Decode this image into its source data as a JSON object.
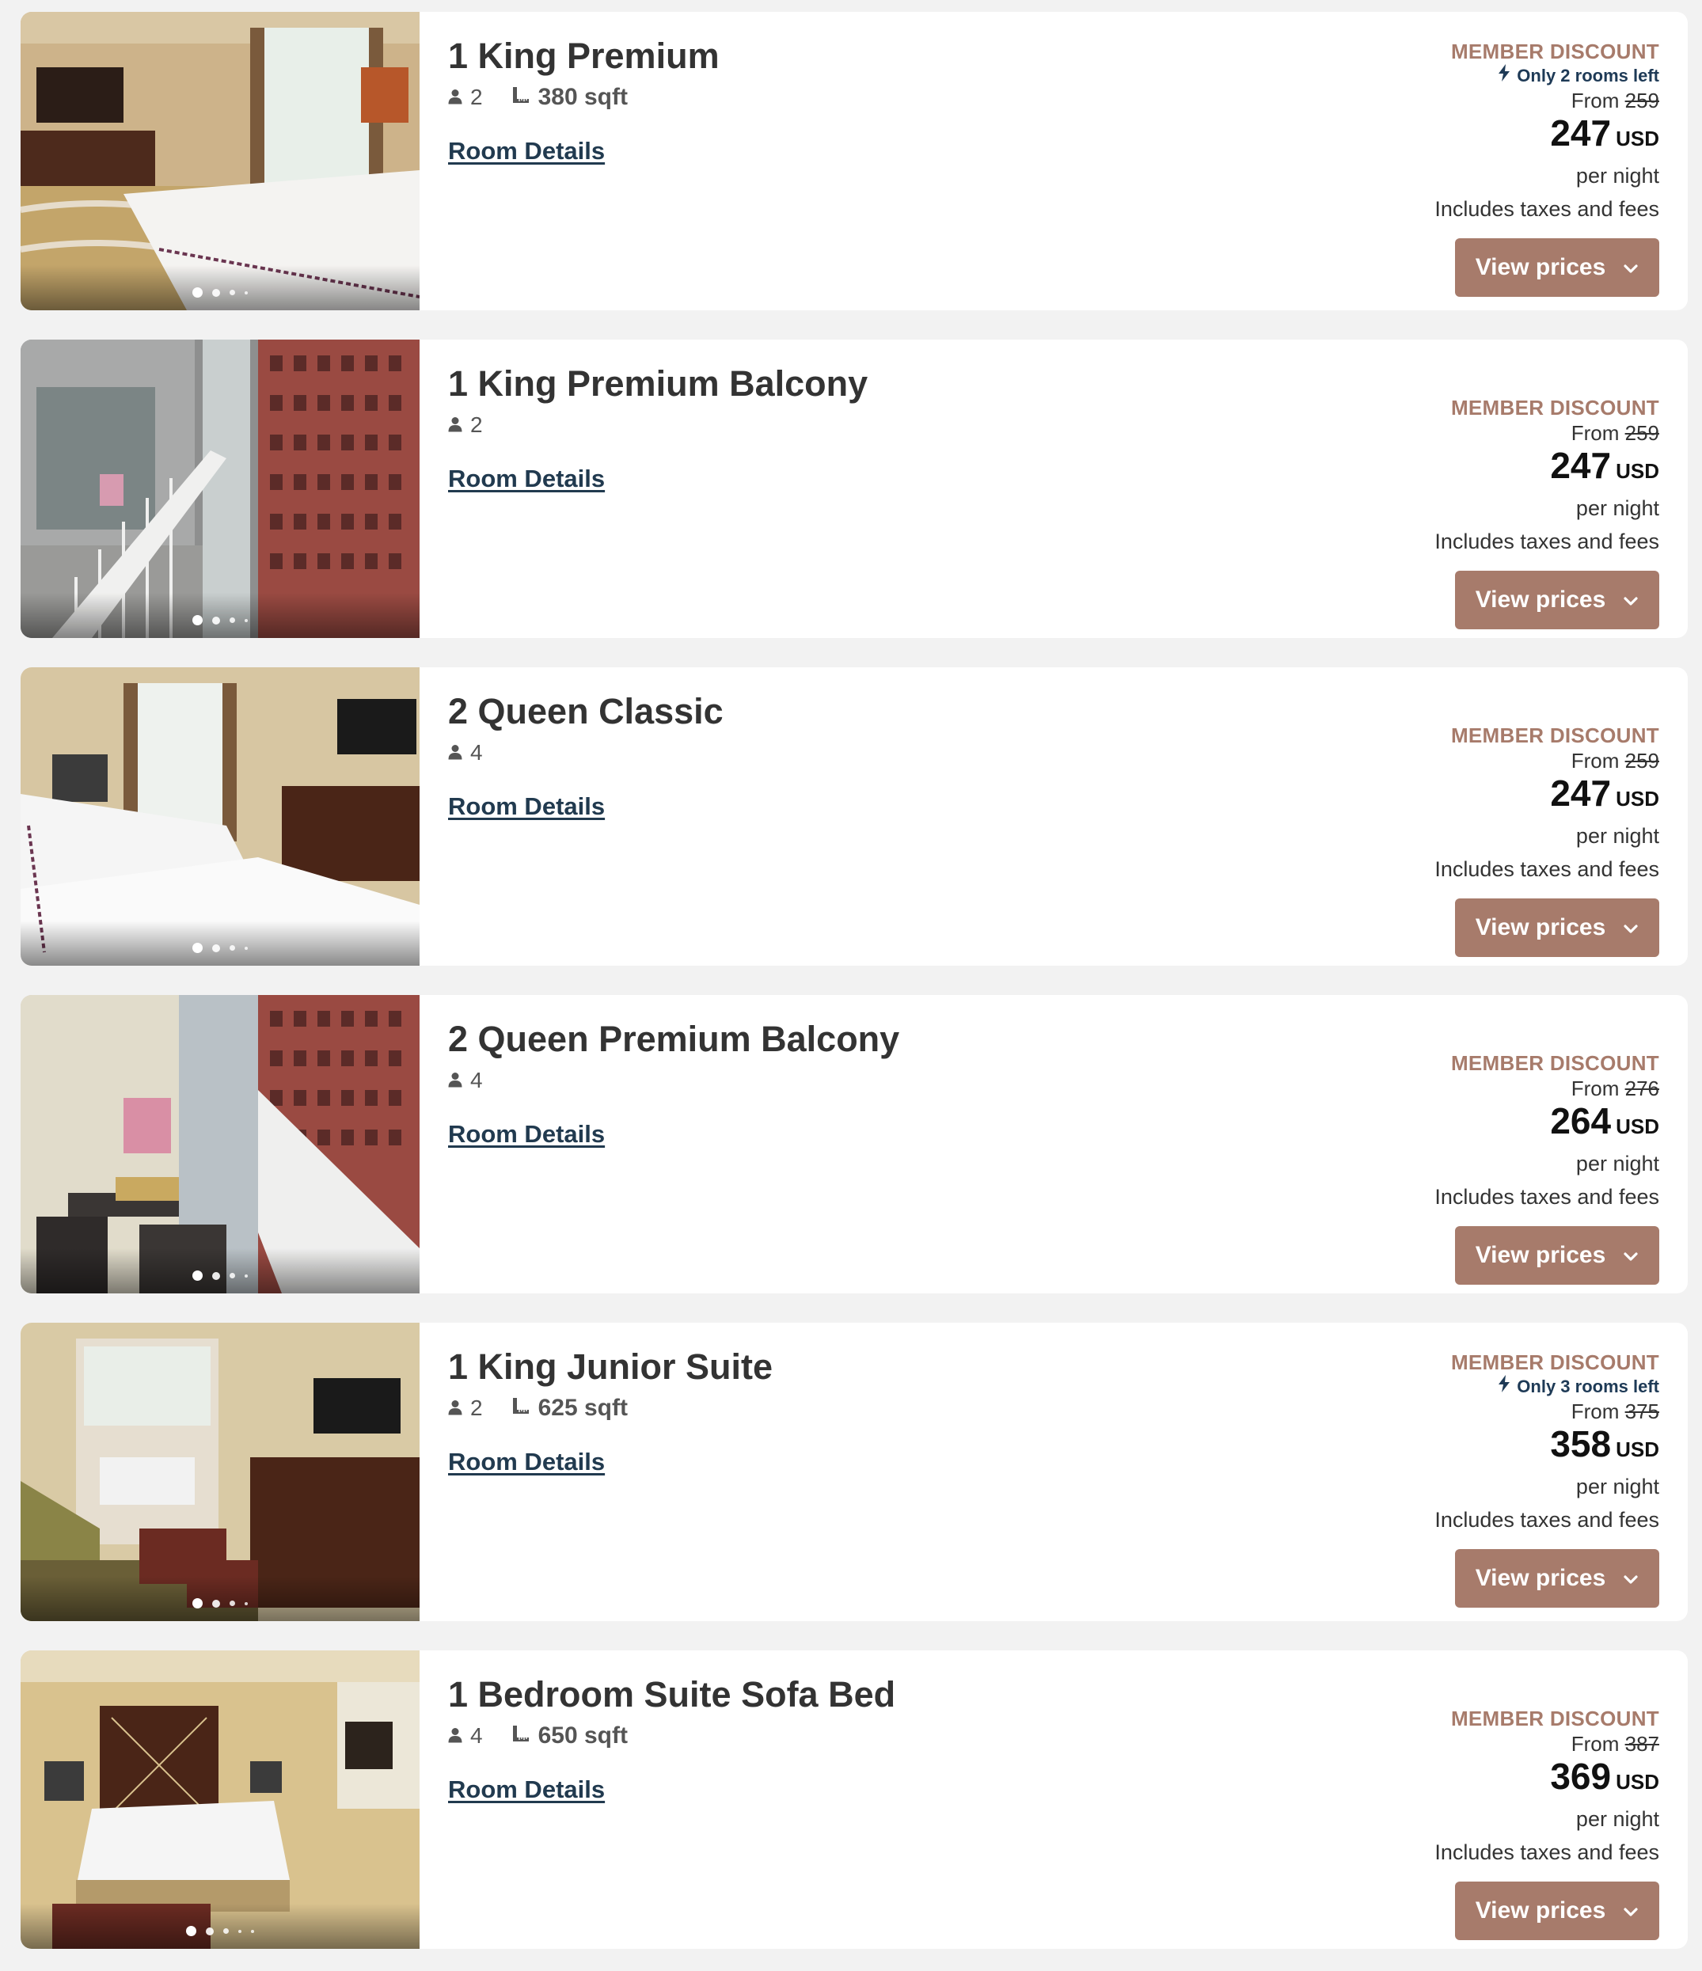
{
  "colors": {
    "page_background": "#f2f2f2",
    "card_background": "#ffffff",
    "accent": "#a77b6b",
    "link": "#213a4f",
    "urgency": "#1e3a56"
  },
  "labels": {
    "member_discount": "MEMBER DISCOUNT",
    "room_details": "Room Details",
    "from": "From",
    "currency": "USD",
    "per_night": "per night",
    "taxes": "Includes taxes and fees",
    "view_prices": "View prices"
  },
  "icons": {
    "guests": "person-icon",
    "size": "ruler-icon",
    "alert": "lightning-icon",
    "expand": "chevron-down-icon"
  },
  "rooms": [
    {
      "title": "1 King Premium",
      "guests": "2",
      "sqft": "380 sqft",
      "alert": "Only 2 rooms left",
      "original_price": "259",
      "price": "247",
      "photo": "bedroom-king",
      "photo_index": 1,
      "photo_count": 4
    },
    {
      "title": "1 King Premium Balcony",
      "guests": "2",
      "sqft": "",
      "alert": "",
      "original_price": "259",
      "price": "247",
      "photo": "balcony-atrium",
      "photo_index": 1,
      "photo_count": 4
    },
    {
      "title": "2 Queen Classic",
      "guests": "4",
      "sqft": "",
      "alert": "",
      "original_price": "259",
      "price": "247",
      "photo": "bedroom-two-queens",
      "photo_index": 1,
      "photo_count": 4
    },
    {
      "title": "2 Queen Premium Balcony",
      "guests": "4",
      "sqft": "",
      "alert": "",
      "original_price": "276",
      "price": "264",
      "photo": "balcony-orchids",
      "photo_index": 1,
      "photo_count": 4
    },
    {
      "title": "1 King Junior Suite",
      "guests": "2",
      "sqft": "625 sqft",
      "alert": "Only 3 rooms left",
      "original_price": "375",
      "price": "358",
      "photo": "junior-suite",
      "photo_index": 1,
      "photo_count": 4
    },
    {
      "title": "1 Bedroom Suite Sofa Bed",
      "guests": "4",
      "sqft": "650 sqft",
      "alert": "",
      "original_price": "387",
      "price": "369",
      "photo": "bedroom-suite",
      "photo_index": 1,
      "photo_count": 5
    }
  ]
}
